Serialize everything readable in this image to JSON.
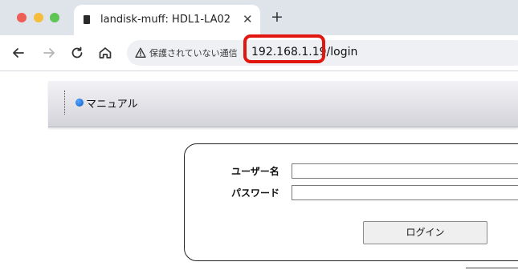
{
  "browser": {
    "tab": {
      "title": "landisk-muff: HDL1-LA02"
    },
    "address_bar": {
      "security_text": "保護されていない通信",
      "url": "192.168.1.19/login"
    },
    "colors": {
      "highlight": "#e0160f"
    }
  },
  "page": {
    "header": {
      "manual_link": "マニュアル"
    },
    "login_form": {
      "username_label": "ユーザー名",
      "password_label": "パスワード",
      "username_value": "",
      "password_value": "",
      "login_button": "ログイン"
    }
  }
}
